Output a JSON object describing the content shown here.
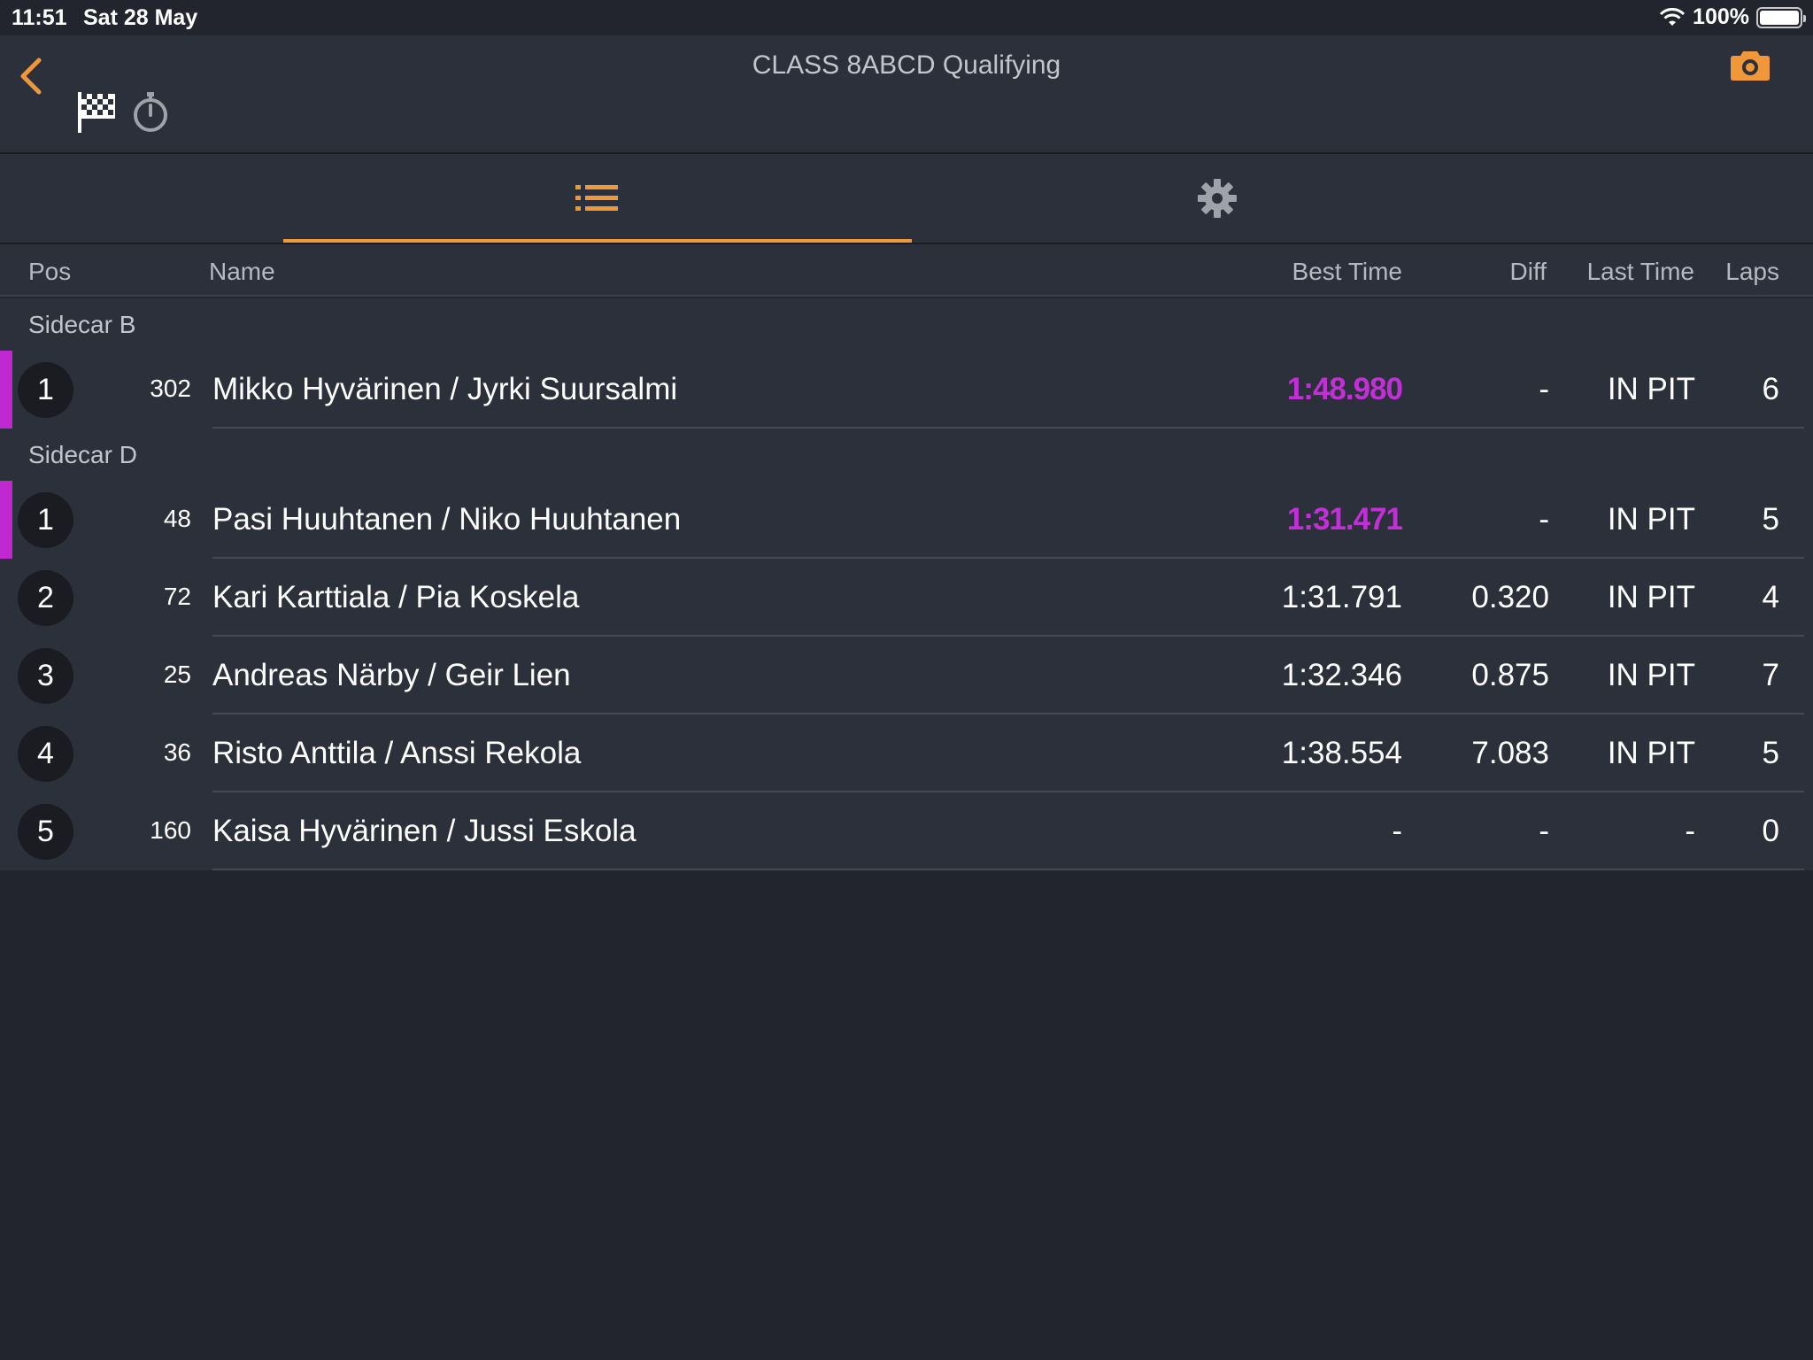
{
  "status": {
    "time": "11:51",
    "date": "Sat 28 May",
    "battery": "100%"
  },
  "nav": {
    "title": "CLASS 8ABCD Qualifying"
  },
  "icons": {
    "back": "chevron-left-icon",
    "flag": "checkered-flag-icon",
    "stopwatch": "stopwatch-icon",
    "camera": "camera-icon",
    "list": "list-icon",
    "settings": "gear-icon",
    "wifi": "wifi-icon",
    "battery": "battery-icon"
  },
  "colors": {
    "accent": "#f0973a",
    "best_lap": "#c32fd6",
    "background": "#22252e",
    "row": "#2c303a"
  },
  "columns": {
    "pos": "Pos",
    "name": "Name",
    "best": "Best Time",
    "diff": "Diff",
    "last": "Last Time",
    "laps": "Laps"
  },
  "groups": [
    {
      "title": "Sidecar B",
      "rows": [
        {
          "pos": "1",
          "num": "302",
          "name": "Mikko Hyvärinen /  Jyrki Suursalmi",
          "best": "1:48.980",
          "diff": "-",
          "last": "IN PIT",
          "laps": "6"
        }
      ]
    },
    {
      "title": "Sidecar D",
      "rows": [
        {
          "pos": "1",
          "num": "48",
          "name": "Pasi Huuhtanen / Niko Huuhtanen",
          "best": "1:31.471",
          "diff": "-",
          "last": "IN PIT",
          "laps": "5"
        },
        {
          "pos": "2",
          "num": "72",
          "name": "Kari Karttiala / Pia Koskela",
          "best": "1:31.791",
          "diff": "0.320",
          "last": "IN PIT",
          "laps": "4"
        },
        {
          "pos": "3",
          "num": "25",
          "name": "Andreas Närby / Geir Lien",
          "best": "1:32.346",
          "diff": "0.875",
          "last": "IN PIT",
          "laps": "7"
        },
        {
          "pos": "4",
          "num": "36",
          "name": "Risto Anttila / Anssi Rekola",
          "best": "1:38.554",
          "diff": "7.083",
          "last": "IN PIT",
          "laps": "5"
        },
        {
          "pos": "5",
          "num": "160",
          "name": "Kaisa Hyvärinen / Jussi Eskola",
          "best": "-",
          "diff": "-",
          "last": "-",
          "laps": "0"
        }
      ]
    }
  ]
}
